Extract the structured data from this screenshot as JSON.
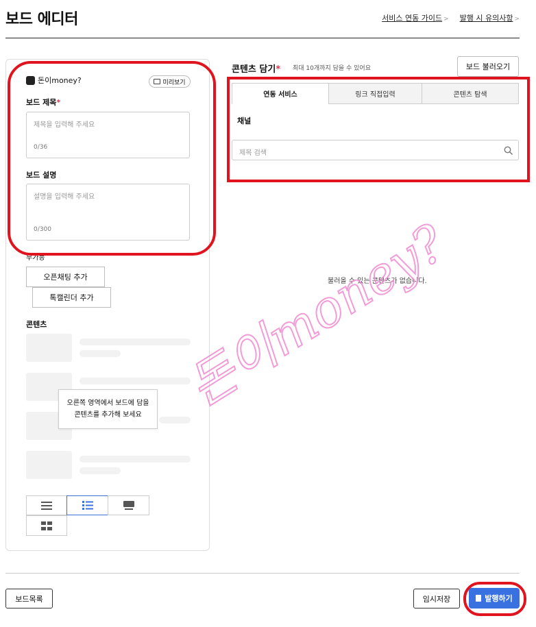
{
  "header": {
    "title": "보드 에디터",
    "links": [
      "서비스 연동 가이드",
      "발행 시 유의사항"
    ]
  },
  "left": {
    "brand": "돈이money?",
    "preview_label": "미리보기",
    "title_label": "보드 제목",
    "title_placeholder": "제목을 입력해 주세요",
    "title_counter": "0/36",
    "desc_label": "보드 설명",
    "desc_placeholder": "설명을 입력해 주세요",
    "desc_counter": "0/300",
    "features_label": "부가능",
    "openchat_button": "오픈채팅 추가",
    "calendar_button": "톡캘린더 추가",
    "content_label": "콘텐츠",
    "tooltip_line1": "오른쪽 영역에서 보드에 담을",
    "tooltip_line2": "콘텐츠를 추가해 보세요",
    "view_icons": [
      "list-compact-icon",
      "list-bullet-icon",
      "card-large-icon",
      "grid-icon"
    ],
    "selected_view": 1
  },
  "right": {
    "title": "콘텐츠 담기",
    "subtitle": "최대 10개까지 담을 수 있어요",
    "load_button": "보드 불러오기",
    "tabs": [
      "연동 서비스",
      "링크 직접입력",
      "콘텐츠 탐색"
    ],
    "active_tab": 0,
    "channel_label": "채널",
    "search_placeholder": "제목 검색",
    "empty_message": "불러올 수 있는 콘텐츠가 없습니다."
  },
  "footer": {
    "list_button": "보드목록",
    "save_button": "임시저장",
    "publish_button": "발행하기"
  },
  "watermark": "돈이money?",
  "colors": {
    "accent": "#3a71e0",
    "highlight_ring": "#e0141e",
    "required": "#e0304a",
    "watermark": "#f08ad0"
  }
}
